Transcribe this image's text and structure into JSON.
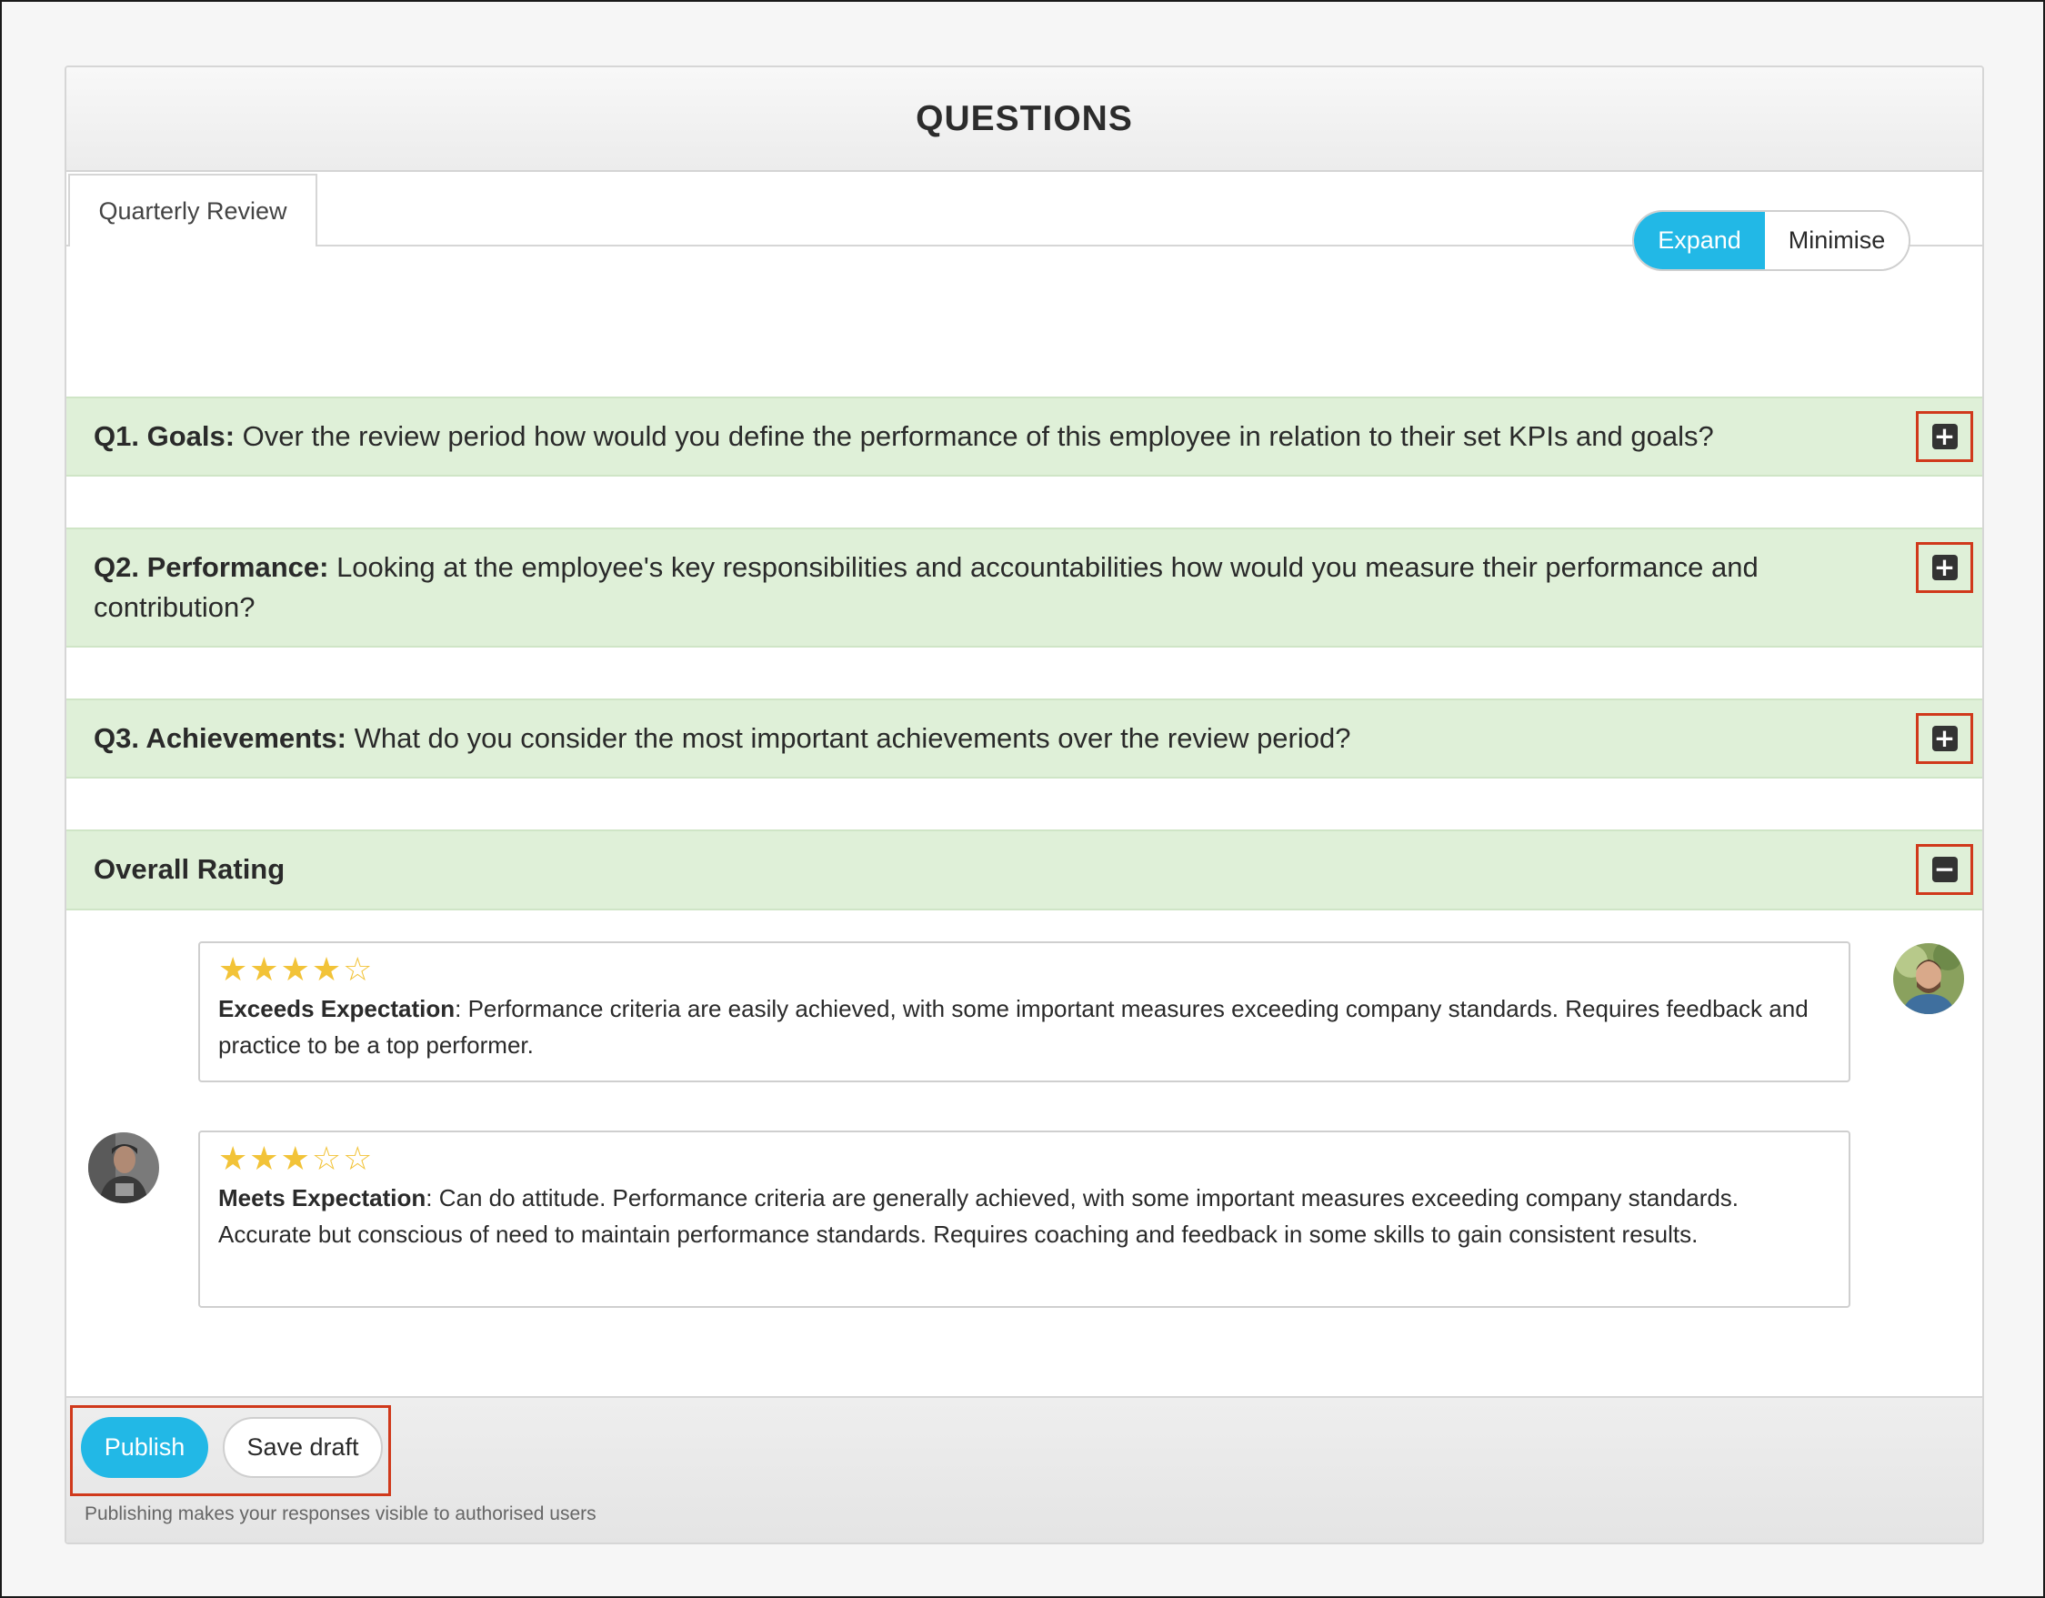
{
  "header": {
    "title": "QUESTIONS"
  },
  "tabs": [
    {
      "label": "Quarterly Review",
      "active": true
    }
  ],
  "view_toggle": {
    "expand_label": "Expand",
    "minimise_label": "Minimise",
    "selected": "Expand"
  },
  "questions": [
    {
      "number_title": "Q1. Goals:",
      "text": "Over the review period how would you define the performance of this employee in relation to their set KPIs and goals?",
      "toggle_icon": "plus-icon"
    },
    {
      "number_title": "Q2. Performance:",
      "text": "Looking at the employee's key responsibilities and accountabilities how would you measure their performance and contribution?",
      "toggle_icon": "plus-icon"
    },
    {
      "number_title": "Q3. Achievements:",
      "text": "What do you consider the most important achievements over the review period?",
      "toggle_icon": "plus-icon"
    }
  ],
  "overall_rating": {
    "title": "Overall Rating",
    "toggle_icon": "minus-icon",
    "responses": [
      {
        "stars": 4,
        "max_stars": 5,
        "level": "Exceeds Expectation",
        "description": ": Performance criteria are easily achieved, with some important measures exceeding company standards. Requires feedback and practice to be a top performer.",
        "avatar_side": "right"
      },
      {
        "stars": 3,
        "max_stars": 5,
        "level": "Meets Expectation",
        "description": ": Can do attitude. Performance criteria are generally achieved, with some important measures exceeding company standards. Accurate but conscious of need to maintain performance standards. Requires coaching and feedback in some skills to gain consistent results.",
        "avatar_side": "left"
      }
    ]
  },
  "footer": {
    "publish_label": "Publish",
    "save_draft_label": "Save draft",
    "note": "Publishing makes your responses visible to authorised users"
  },
  "colors": {
    "accent": "#22b8e6",
    "question_bg": "#dff0d8",
    "highlight": "#d0391b",
    "star": "#f2c338"
  }
}
